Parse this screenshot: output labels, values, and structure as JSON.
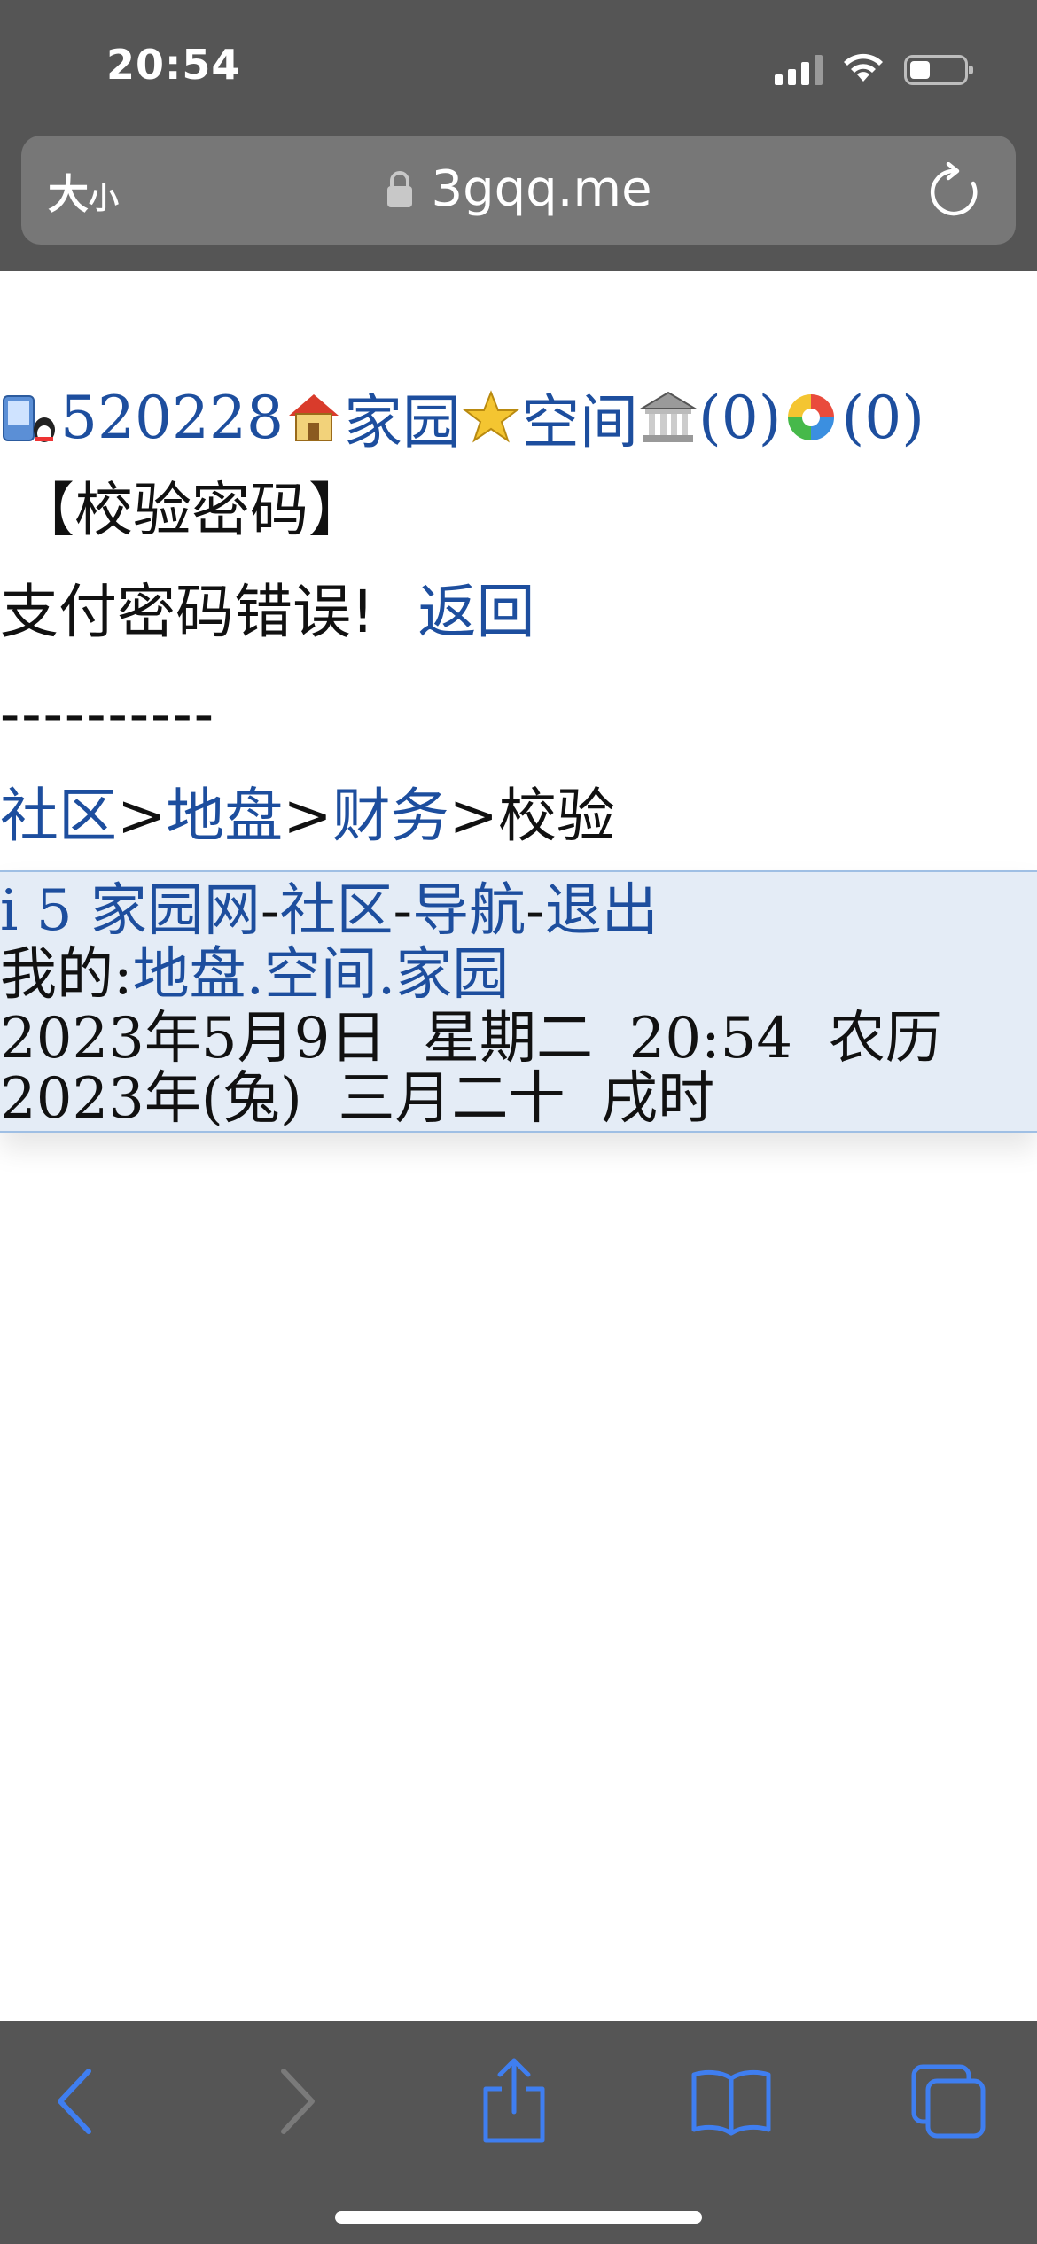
{
  "status_bar": {
    "time": "20:54"
  },
  "browser": {
    "text_size_big": "大",
    "text_size_small": "小",
    "url": "3gqq.me"
  },
  "page": {
    "nav": {
      "user_id": "520228",
      "home_label": "家园",
      "space_label": "空间",
      "bank_count": "(0)",
      "album_count": "(0)"
    },
    "title": "【校验密码】",
    "error_message": "支付密码错误!",
    "back_link": "返回",
    "divider": "----------",
    "breadcrumb": {
      "items": [
        "社区",
        "地盘",
        "财务"
      ],
      "current": "校验",
      "separator": ">"
    },
    "footer": {
      "site_name": "i 5 家园网",
      "community": "社区",
      "navigation": "导航",
      "logout": "退出",
      "dash": "-",
      "my_label": "我的:",
      "my_links": [
        "地盘",
        "空间",
        "家园"
      ],
      "dot": ".",
      "date_line": "2023年5月9日  星期二  20:54  农历",
      "lunar_line": "2023年(兔)  三月二十  戌时"
    }
  },
  "icons": {
    "accent_color": "#1d4e9e",
    "toolbar_active": "#3f7ef0",
    "toolbar_disabled": "#7a7a7a"
  }
}
